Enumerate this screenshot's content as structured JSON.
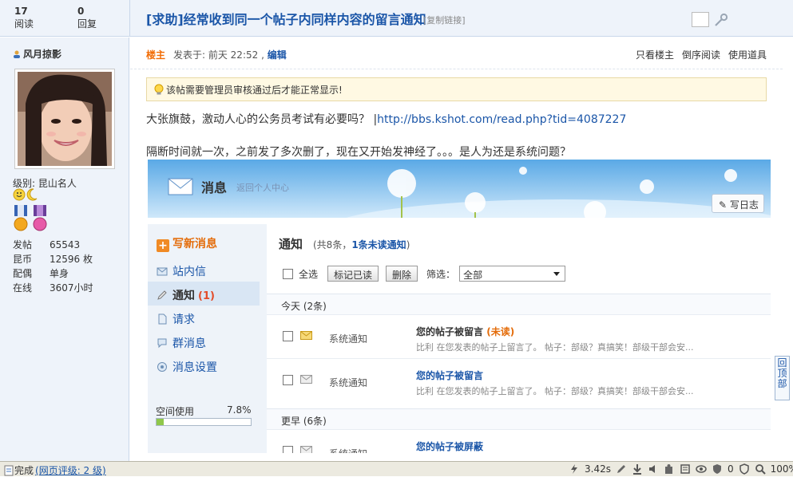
{
  "header": {
    "views_count": "17",
    "views_label": "阅读",
    "replies_count": "0",
    "replies_label": "回复",
    "title": "[求助]经常收到同一个帖子内同样内容的留言通知",
    "copy_link": "[复制链接]"
  },
  "user": {
    "name": "风月掠影",
    "level": "级别: 昆山名人",
    "stats": [
      {
        "key": "发帖",
        "value": "65543"
      },
      {
        "key": "昆币",
        "value": "12596 枚"
      },
      {
        "key": "配偶",
        "value": "单身"
      },
      {
        "key": "在线",
        "value": "3607小时"
      }
    ]
  },
  "post": {
    "floor": "楼主",
    "posted_prefix": "发表于: 前天 22:52 ,",
    "edit": "编辑",
    "actions": [
      "只看楼主",
      "倒序阅读",
      "使用道具"
    ],
    "notice": "该帖需要管理员审核通过后才能正常显示!",
    "line1_text": "大张旗鼓，激动人心的公务员考试有必要吗？ |",
    "line1_link": "http://bbs.kshot.com/read.php?tid=4087227",
    "line2_text": "隔断时间就一次，之前发了多次删了，现在又开始发神经了。。。是人为还是系统问题？"
  },
  "embed": {
    "banner_title": "消息",
    "banner_sub": "返回个人中心",
    "write_button": "写日志",
    "compose": "写新消息",
    "nav": [
      {
        "label": "站内信",
        "count": ""
      },
      {
        "label": "通知",
        "count": "(1)"
      },
      {
        "label": "请求",
        "count": ""
      },
      {
        "label": "群消息",
        "count": ""
      },
      {
        "label": "消息设置",
        "count": ""
      }
    ],
    "space_label": "空间使用",
    "space_value": "7.8%",
    "space_fraction": 0.078,
    "panel_title": "通知",
    "summary_prefix": "(共8条，",
    "summary_link": "1条未读通知",
    "summary_suffix": ")",
    "select_all": "全选",
    "mark_read": "标记已读",
    "delete": "删除",
    "filter_label": "筛选：",
    "filter_value": "全部",
    "group_today": "今天 (2条)",
    "group_earlier": "更早 (6条)",
    "messages": [
      {
        "sender": "系统通知",
        "subject": "您的帖子被留言",
        "status": "(未读)",
        "preview": "比利 在您发表的帖子上留言了。 帖子：部级？真搞笑！部级干部会安..."
      },
      {
        "sender": "系统通知",
        "subject": "您的帖子被留言",
        "status": "",
        "preview": "比利 在您发表的帖子上留言了。 帖子：部级？真搞笑！部级干部会安..."
      },
      {
        "sender": "系统通知",
        "subject": "您的帖子被屏蔽",
        "status": "",
        "preview": ""
      }
    ]
  },
  "back_to_top": "回顶部",
  "statusbar": {
    "done": "完成",
    "rating": "(网页评级: 2 级)",
    "time": "3.42s",
    "count": "0",
    "zoom": "100%"
  },
  "colors": {
    "accent_blue": "#1b56a8",
    "accent_orange": "#e46c0a",
    "header_bg": "#eef3fa"
  }
}
